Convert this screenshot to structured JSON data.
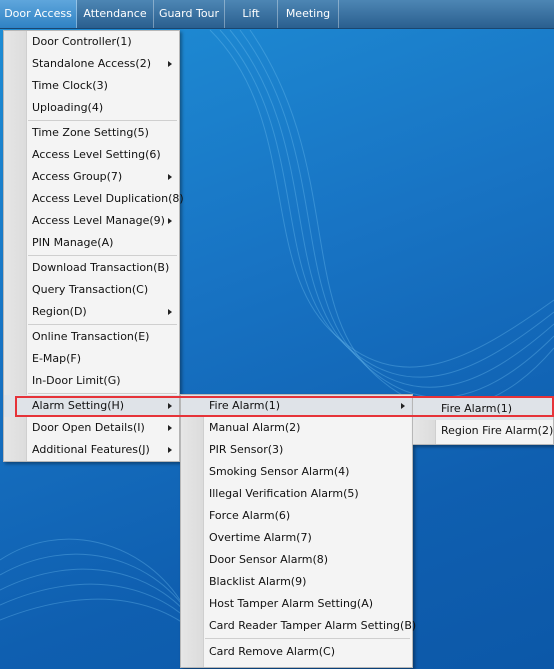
{
  "menubar": {
    "items": [
      "Door Access",
      "Attendance",
      "Guard Tour",
      "Lift",
      "Meeting"
    ]
  },
  "door_access_menu": {
    "groups": [
      [
        "Door Controller(1)",
        "Standalone Access(2)",
        "Time Clock(3)",
        "Uploading(4)"
      ],
      [
        "Time Zone Setting(5)",
        "Access Level Setting(6)",
        "Access Group(7)",
        "Access Level Duplication(8)",
        "Access Level Manage(9)",
        "PIN Manage(A)"
      ],
      [
        "Download Transaction(B)",
        "Query Transaction(C)",
        "Region(D)"
      ],
      [
        "Online Transaction(E)",
        "E-Map(F)",
        "In-Door Limit(G)"
      ],
      [
        "Alarm Setting(H)",
        "Door Open Details(I)",
        "Additional Features(J)"
      ]
    ]
  },
  "alarm_setting_menu": {
    "items": [
      "Fire Alarm(1)",
      "Manual Alarm(2)",
      "PIR Sensor(3)",
      "Smoking Sensor Alarm(4)",
      "Illegal Verification Alarm(5)",
      "Force Alarm(6)",
      "Overtime Alarm(7)",
      "Door Sensor Alarm(8)",
      "Blacklist Alarm(9)",
      "Host Tamper Alarm Setting(A)",
      "Card Reader Tamper Alarm Setting(B)",
      "Card Remove Alarm(C)"
    ]
  },
  "fire_alarm_menu": {
    "items": [
      "Fire Alarm(1)",
      "Region Fire Alarm(2)"
    ]
  },
  "colors": {
    "highlight": "#e63339",
    "menubar": "#2a5f8f"
  }
}
